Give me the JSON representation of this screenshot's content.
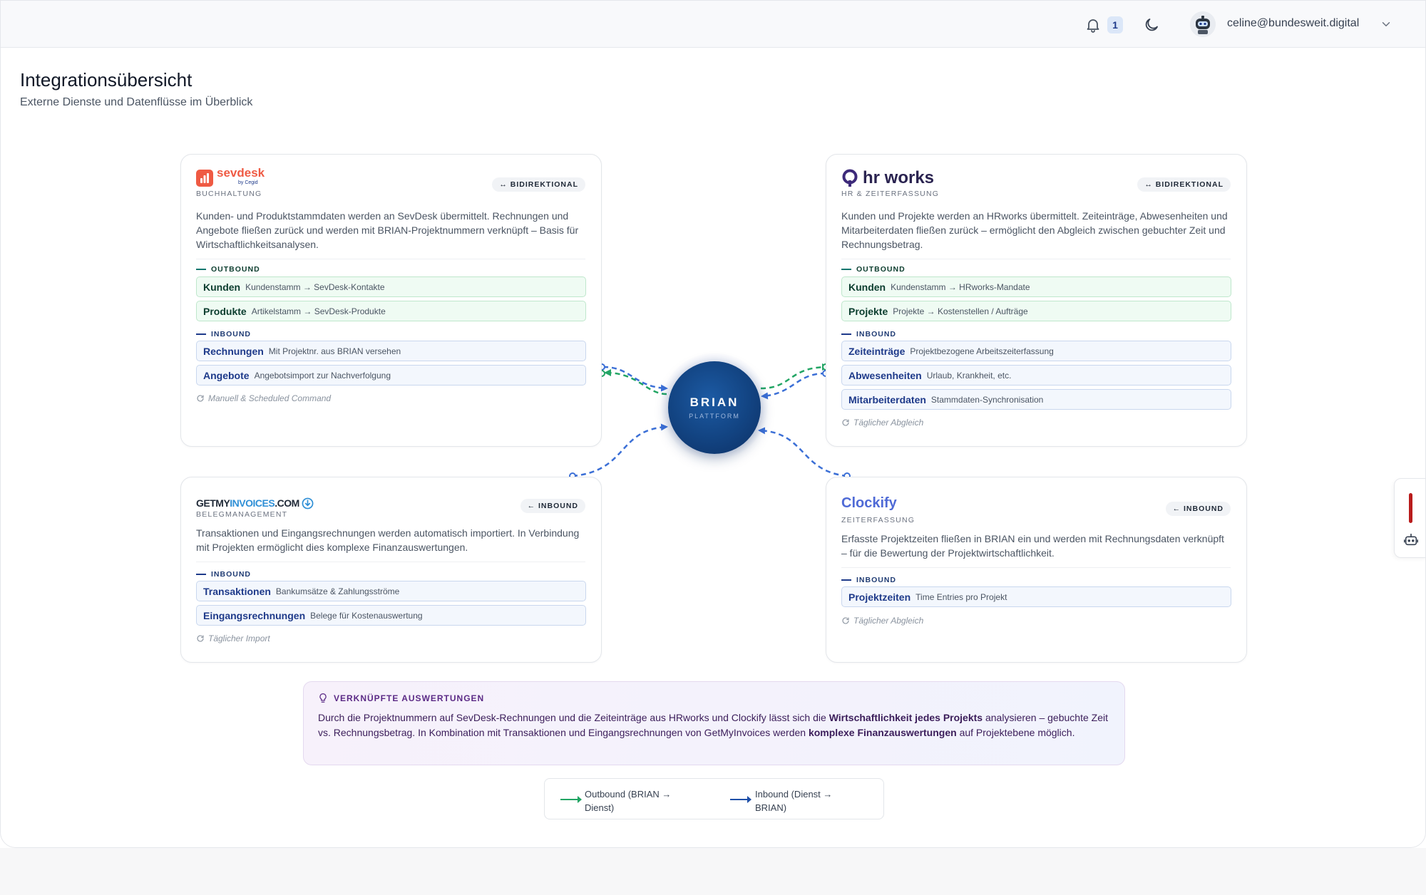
{
  "header": {
    "notification_count": "1",
    "user_email": "celine@bundesweit.digital"
  },
  "page": {
    "title": "Integrationsübersicht",
    "subtitle": "Externe Dienste und Datenflüsse im Überblick"
  },
  "hub": {
    "title": "BRIAN",
    "subtitle": "PLATTFORM"
  },
  "cards": {
    "sevdesk": {
      "logo_text": "sevdesk",
      "logo_sub": "by Cegid",
      "category": "BUCHHALTUNG",
      "direction": "↔ BIDIREKTIONAL",
      "description": "Kunden- und Produktstammdaten werden an SevDesk übermittelt. Rechnungen und Angebote fließen zurück und werden mit BRIAN-Projektnummern verknüpft – Basis für Wirtschaftlichkeitsanalysen.",
      "outbound_label": "OUTBOUND",
      "inbound_label": "INBOUND",
      "outbound": [
        {
          "name": "Kunden",
          "desc": "Kundenstamm → SevDesk-Kontakte"
        },
        {
          "name": "Produkte",
          "desc": "Artikelstamm → SevDesk-Produkte"
        }
      ],
      "inbound": [
        {
          "name": "Rechnungen",
          "desc": "Mit Projektnr. aus BRIAN versehen"
        },
        {
          "name": "Angebote",
          "desc": "Angebotsimport zur Nachverfolgung"
        }
      ],
      "sync": "Manuell & Scheduled Command"
    },
    "hrworks": {
      "logo_text": "hr works",
      "category": "HR & ZEITERFASSUNG",
      "direction": "↔ BIDIREKTIONAL",
      "description": "Kunden und Projekte werden an HRworks übermittelt. Zeiteinträge, Abwesenheiten und Mitarbeiterdaten fließen zurück – ermöglicht den Abgleich zwischen gebuchter Zeit und Rechnungsbetrag.",
      "outbound_label": "OUTBOUND",
      "inbound_label": "INBOUND",
      "outbound": [
        {
          "name": "Kunden",
          "desc": "Kundenstamm → HRworks-Mandate"
        },
        {
          "name": "Projekte",
          "desc": "Projekte → Kostenstellen / Aufträge"
        }
      ],
      "inbound": [
        {
          "name": "Zeiteinträge",
          "desc": "Projektbezogene Arbeitszeiterfassung"
        },
        {
          "name": "Abwesenheiten",
          "desc": "Urlaub, Krankheit, etc."
        },
        {
          "name": "Mitarbeiterdaten",
          "desc": "Stammdaten-Synchronisation"
        }
      ],
      "sync": "Täglicher Abgleich"
    },
    "getmyinvoices": {
      "logo_part1": "GETMY",
      "logo_part2": "INVOICES",
      "logo_part3": ".COM",
      "category": "BELEGMANAGEMENT",
      "direction": "← INBOUND",
      "description": "Transaktionen und Eingangsrechnungen werden automatisch importiert. In Verbindung mit Projekten ermöglicht dies komplexe Finanzauswertungen.",
      "inbound_label": "INBOUND",
      "inbound": [
        {
          "name": "Transaktionen",
          "desc": "Bankumsätze & Zahlungsströme"
        },
        {
          "name": "Eingangsrechnungen",
          "desc": "Belege für Kostenauswertung"
        }
      ],
      "sync": "Täglicher Import"
    },
    "clockify": {
      "logo_text": "Clockify",
      "category": "ZEITERFASSUNG",
      "direction": "← INBOUND",
      "description": "Erfasste Projektzeiten fließen in BRIAN ein und werden mit Rechnungsdaten verknüpft – für die Bewertung der Projektwirtschaftlichkeit.",
      "inbound_label": "INBOUND",
      "inbound": [
        {
          "name": "Projektzeiten",
          "desc": "Time Entries pro Projekt"
        }
      ],
      "sync": "Täglicher Abgleich"
    }
  },
  "insight": {
    "title": "VERKNÜPFTE AUSWERTUNGEN",
    "text_1": "Durch die Projektnummern auf SevDesk-Rechnungen und die Zeiteinträge aus HRworks und Clockify lässt sich die ",
    "bold_1": "Wirtschaftlichkeit jedes Projekts",
    "text_2": " analysieren – gebuchte Zeit vs. Rechnungsbetrag. In Kombination mit Transaktionen und Eingangsrechnungen von GetMyInvoices werden ",
    "bold_2": "komplexe Finanzauswertungen",
    "text_3": " auf Projektebene möglich."
  },
  "legend": {
    "outbound": "Outbound (BRIAN → Dienst)",
    "inbound": "Inbound (Dienst → BRIAN)"
  },
  "colors": {
    "outbound": "#22a564",
    "inbound": "#3b6fd6",
    "hub": "#124381",
    "accent_purple": "#5b2a86"
  }
}
